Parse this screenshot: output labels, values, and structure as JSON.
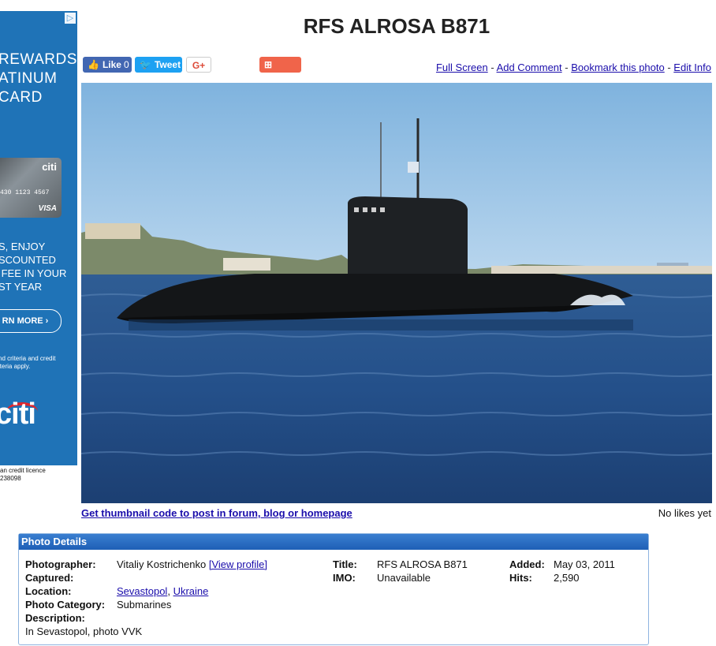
{
  "ad": {
    "headline": "REWARDS\nATINUM\nCARD",
    "card_brand": "citi",
    "card_number": "430 1123 4567",
    "card_network": "VISA",
    "offer": "S, ENJOY\nSCOUNTED\n FEE IN YOUR\nST YEAR",
    "cta": "RN MORE",
    "fine_print": "nd criteria and credit\niteria apply.",
    "logo": "citi",
    "footer": "an credit licence\n238098"
  },
  "page": {
    "title": "RFS ALROSA B871"
  },
  "social": {
    "facebook_label": "Like",
    "facebook_count": "0",
    "twitter_label": "Tweet",
    "gplus_label": "G+",
    "share_label": "Share"
  },
  "links": {
    "full_screen": "Full Screen",
    "add_comment": "Add Comment",
    "bookmark": "Bookmark this photo",
    "edit_info": "Edit Info",
    "separator": " - "
  },
  "photo": {
    "thumb_link": "Get thumbnail code to post in forum, blog or homepage",
    "likes": "No likes yet"
  },
  "details": {
    "header": "Photo Details",
    "photographer_label": "Photographer:",
    "photographer": "Vitaliy Kostrichenko",
    "view_profile": "[View profile]",
    "captured_label": "Captured:",
    "location_label": "Location:",
    "location_city": "Sevastopol",
    "location_country": "Ukraine",
    "category_label": "Photo Category:",
    "category": "Submarines",
    "description_label": "Description:",
    "description": "In Sevastopol, photo VVK",
    "title_label": "Title:",
    "title": "RFS ALROSA B871",
    "imo_label": "IMO:",
    "imo": "Unavailable",
    "added_label": "Added:",
    "added": "May 03, 2011",
    "hits_label": "Hits:",
    "hits": "2,590"
  }
}
